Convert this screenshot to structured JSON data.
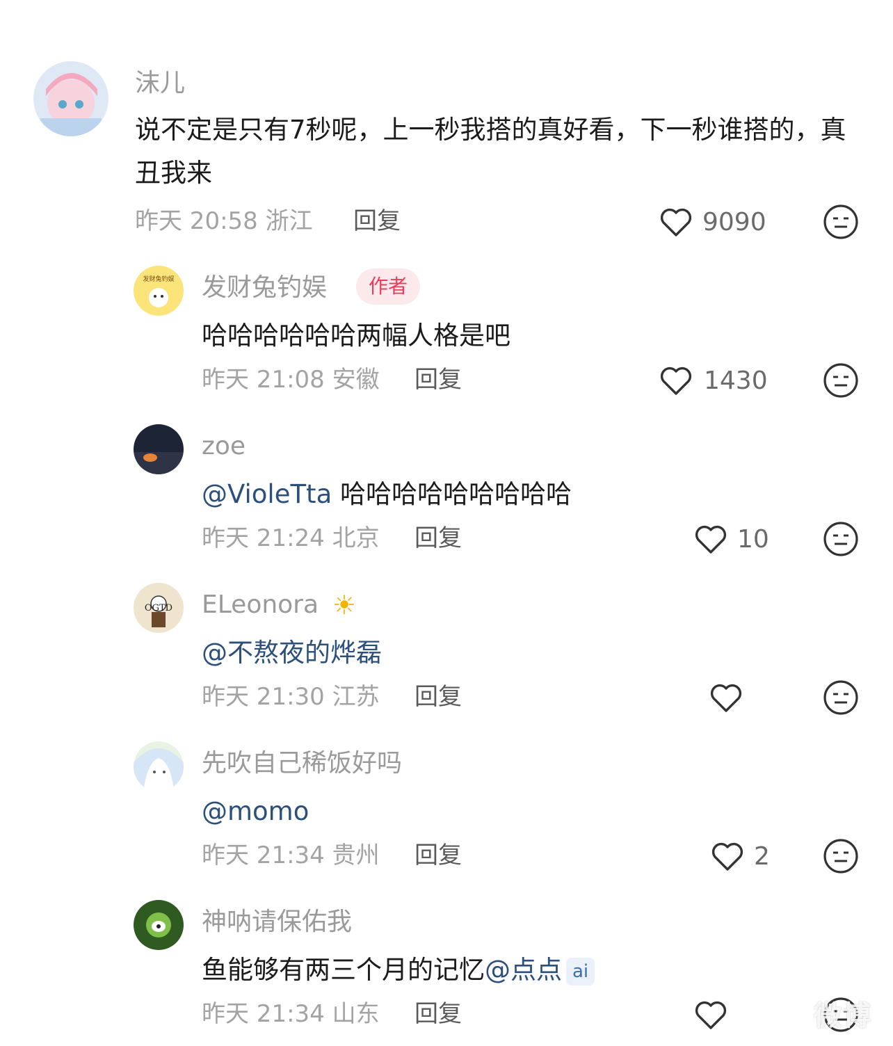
{
  "comments": [
    {
      "user": "沫儿",
      "text": "说不定是只有7秒呢，上一秒我搭的真好看，下一秒谁搭的，真丑我来",
      "time": "昨天 20:58 浙江",
      "reply": "回复",
      "likes": "9090"
    },
    {
      "user": "发财兔钓娱",
      "badge": "作者",
      "text": "哈哈哈哈哈哈两幅人格是吧",
      "time": "昨天 21:08 安徽",
      "reply": "回复",
      "likes": "1430"
    },
    {
      "user": "zoe",
      "mention": "@VioleTta",
      "text": " 哈哈哈哈哈哈哈哈哈",
      "time": "昨天 21:24 北京",
      "reply": "回复",
      "likes": "10"
    },
    {
      "user": "ELeonora",
      "mention": "@不熬夜的烨磊",
      "text": "",
      "time": "昨天 21:30 江苏",
      "reply": "回复",
      "likes": ""
    },
    {
      "user": "先吹自己稀饭好吗",
      "mention": "@momo",
      "text": "",
      "time": "昨天 21:34 贵州",
      "reply": "回复",
      "likes": "2"
    },
    {
      "user": "神呐请保佑我",
      "text": "鱼能够有两三个月的记忆",
      "mention": "@点点",
      "ai_badge": "ai",
      "time": "昨天 21:34 山东",
      "reply": "回复",
      "likes": ""
    }
  ],
  "avatar2_label": "发财兔钓娱",
  "avatar4_label": "OGTD",
  "watermark": "微博"
}
